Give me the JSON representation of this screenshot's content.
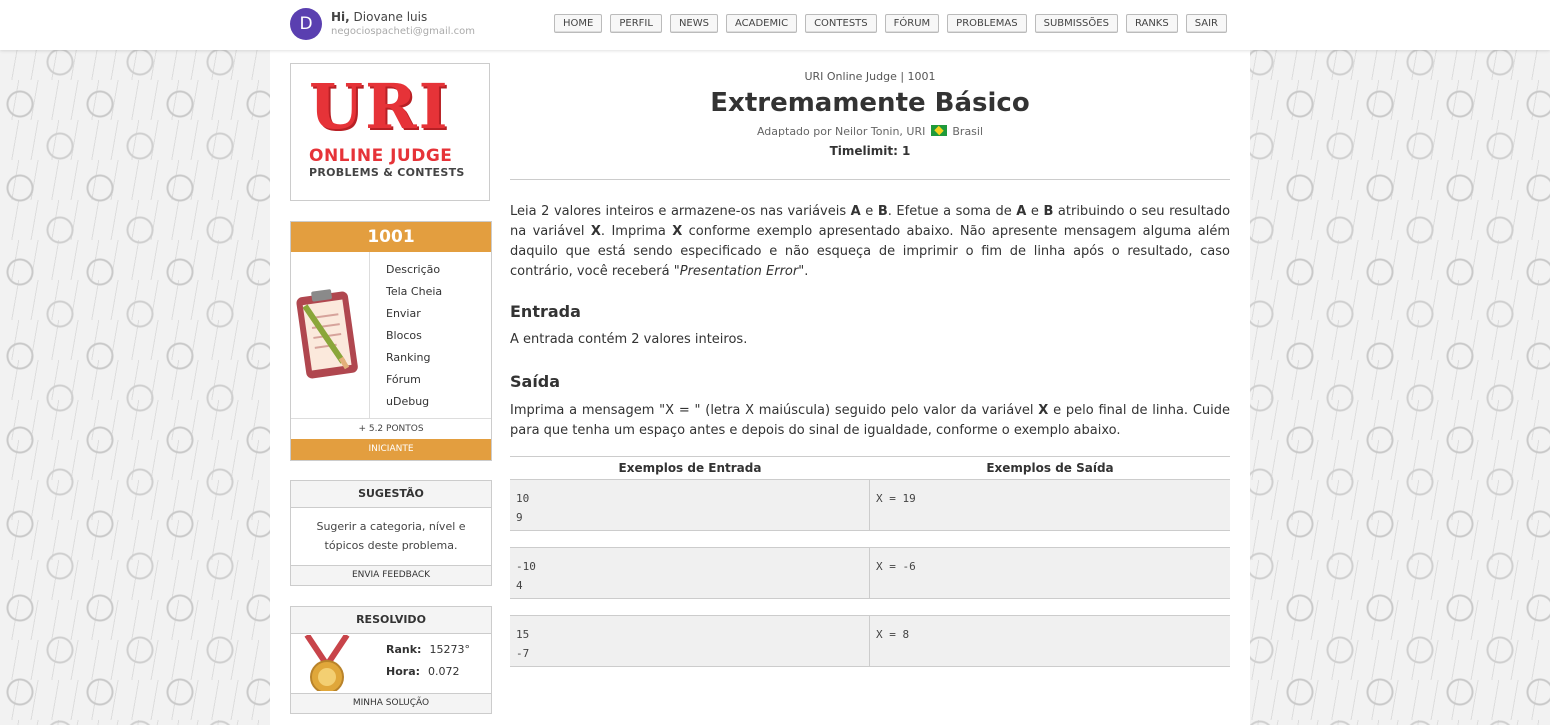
{
  "user": {
    "avatar_letter": "D",
    "greeting_prefix": "Hi,",
    "name": "Diovane luis",
    "email": "negociospacheti@gmail.com"
  },
  "nav": [
    "HOME",
    "PERFIL",
    "NEWS",
    "ACADEMIC",
    "CONTESTS",
    "FÓRUM",
    "PROBLEMAS",
    "SUBMISSÕES",
    "RANKS",
    "SAIR"
  ],
  "logo": {
    "uri": "URI",
    "online_judge": "ONLINE JUDGE",
    "tagline": "PROBLEMS & CONTESTS"
  },
  "problem_box": {
    "number": "1001",
    "menu": [
      "Descrição",
      "Tela Cheia",
      "Enviar",
      "Blocos",
      "Ranking",
      "Fórum",
      "uDebug"
    ],
    "points": "+ 5.2 PONTOS",
    "level": "INICIANTE"
  },
  "suggestion": {
    "title": "SUGESTÃO",
    "text": "Sugerir a categoria, nível e tópicos deste problema.",
    "button": "ENVIA FEEDBACK"
  },
  "resolved": {
    "title": "RESOLVIDO",
    "rank_label": "Rank:",
    "rank_value": "15273°",
    "time_label": "Hora:",
    "time_value": "0.072",
    "button": "MINHA SOLUÇÃO"
  },
  "problem": {
    "breadcrumb": "URI Online Judge | 1001",
    "title": "Extremamente Básico",
    "author_prefix": "Adaptado por Neilor Tonin, URI",
    "country": "Brasil",
    "timelimit": "Timelimit: 1",
    "description_html": "Leia 2 valores inteiros e armazene-os nas variáveis <b>A</b> e <b>B</b>. Efetue a soma de <b>A</b> e <b>B</b> atribuindo o seu resultado na variável <b>X</b>. Imprima <b>X</b> conforme exemplo apresentado abaixo. Não apresente mensagem alguma além daquilo que está sendo especificado e não esqueça de imprimir o fim de linha após o resultado, caso contrário, você receberá \"<i>Presentation Error</i>\".",
    "input_title": "Entrada",
    "input_text": "A entrada contém 2 valores inteiros.",
    "output_title": "Saída",
    "output_html": "Imprima a mensagem \"X = \" (letra X maiúscula) seguido pelo valor da variável <b>X</b> e pelo final de linha. Cuide para que tenha um espaço antes e depois do sinal de igualdade, conforme o exemplo abaixo.",
    "examples_in_header": "Exemplos de Entrada",
    "examples_out_header": "Exemplos de Saída",
    "examples": [
      {
        "input": "10\n9",
        "output": "X = 19"
      },
      {
        "input": "-10\n4",
        "output": "X = -6"
      },
      {
        "input": "15\n-7",
        "output": "X = 8"
      }
    ]
  }
}
